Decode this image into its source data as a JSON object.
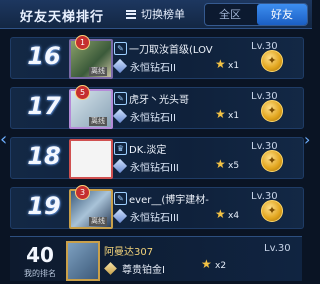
{
  "header": {
    "title": "好友天梯排行",
    "switch_label": "切换榜单",
    "tab_all": "全区",
    "tab_friends": "好友"
  },
  "rows": [
    {
      "rank": "16",
      "badge": "1",
      "role": "离线",
      "name": "一刀取汝首级(LOV",
      "level": "Lv.30",
      "tier": "永恒钻石II",
      "stars": "x1"
    },
    {
      "rank": "17",
      "badge": "5",
      "role": "离线",
      "name": "虎牙丶光头哥",
      "level": "Lv.30",
      "tier": "永恒钻石II",
      "stars": "x1"
    },
    {
      "rank": "18",
      "badge": "",
      "role": "",
      "name": "DK.淡定",
      "level": "Lv.30",
      "tier": "永恒钻石III",
      "stars": "x5"
    },
    {
      "rank": "19",
      "badge": "3",
      "role": "离线",
      "name": "ever__(博宇建材-",
      "level": "Lv.30",
      "tier": "永恒钻石III",
      "stars": "x4"
    }
  ],
  "me": {
    "rank": "40",
    "rank_label": "我的排名",
    "name": "阿曼达307",
    "tier": "尊贵铂金I",
    "stars": "x2",
    "level": "Lv.30"
  },
  "colors": {
    "accent": "#2f7be0",
    "gold": "#f3c244",
    "background": "#0a1424"
  },
  "icons": {
    "switch": "list-icon",
    "gift": "gift-icon",
    "star": "star-icon",
    "tier": "diamond-icon"
  }
}
